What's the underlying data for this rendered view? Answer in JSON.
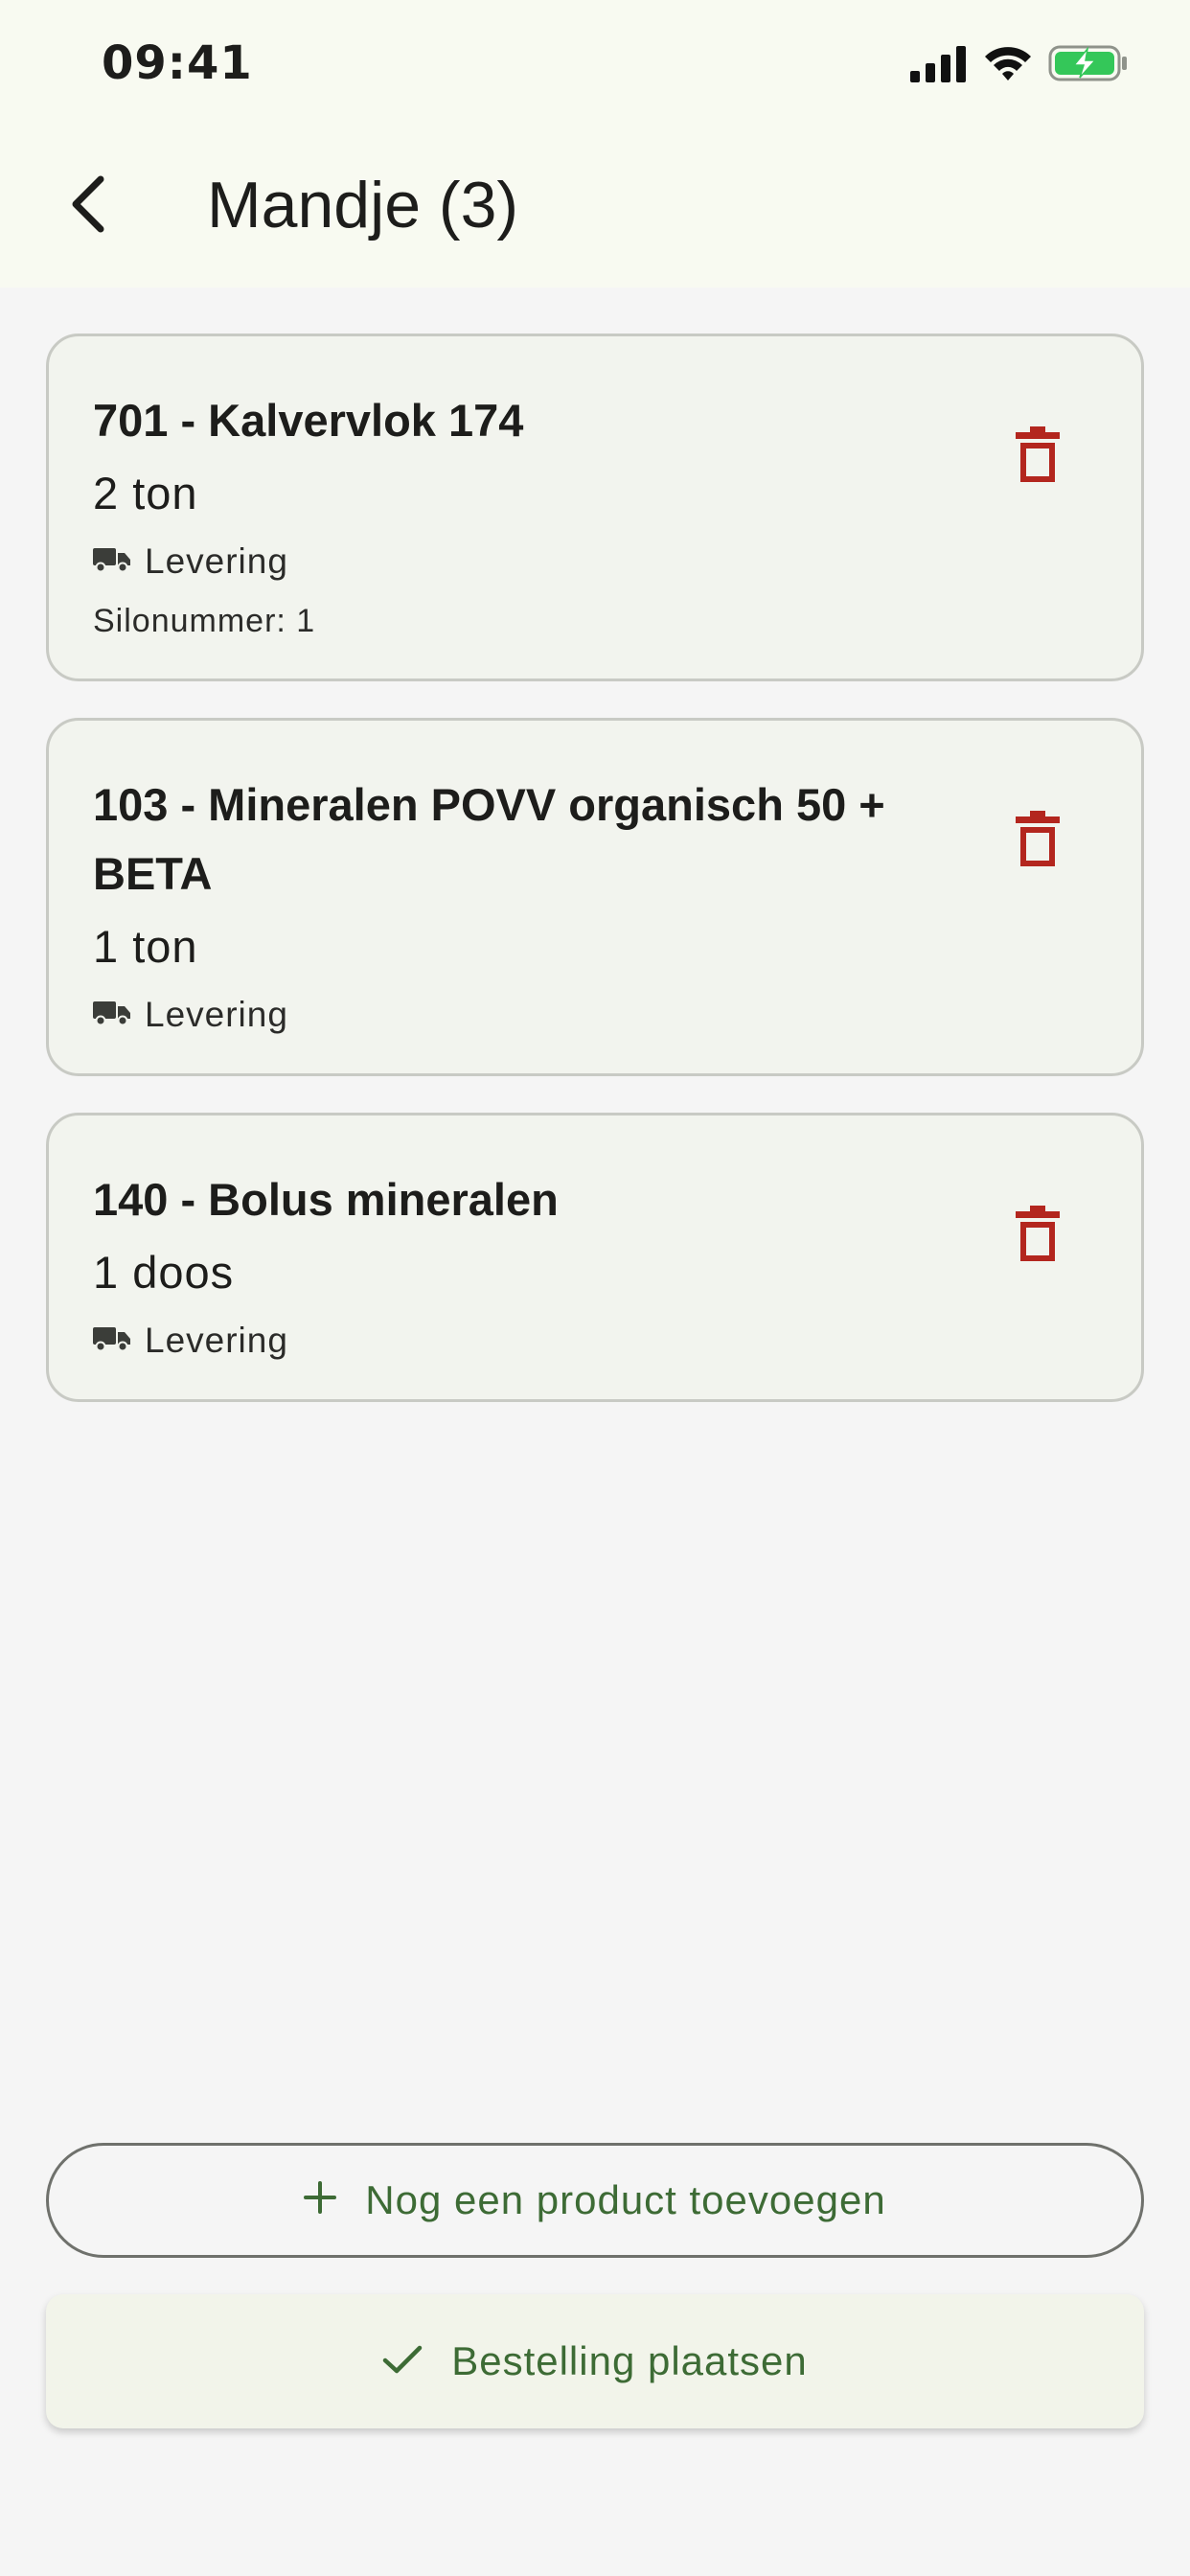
{
  "status_bar": {
    "time": "09:41"
  },
  "header": {
    "title": "Mandje (3)"
  },
  "cart": {
    "items": [
      {
        "name": "701 - Kalvervlok 174",
        "quantity": "2 ton",
        "delivery": "Levering",
        "silo": "Silonummer: 1"
      },
      {
        "name": "103 - Mineralen POVV organisch 50 + BETA",
        "quantity": "1 ton",
        "delivery": "Levering"
      },
      {
        "name": "140 - Bolus mineralen",
        "quantity": "1 doos",
        "delivery": "Levering"
      }
    ]
  },
  "actions": {
    "add_product_label": "Nog een product toevoegen",
    "place_order_label": "Bestelling plaatsen"
  },
  "colors": {
    "accent_green": "#3d6b35",
    "delete_red": "#b3261e",
    "card_background": "#f2f4ee",
    "header_background": "#f8faf1",
    "battery_green": "#34c759"
  },
  "icons": {
    "back": "arrow-back-icon",
    "delete": "trash-icon",
    "delivery": "truck-icon",
    "add": "plus-icon",
    "confirm": "check-icon"
  }
}
